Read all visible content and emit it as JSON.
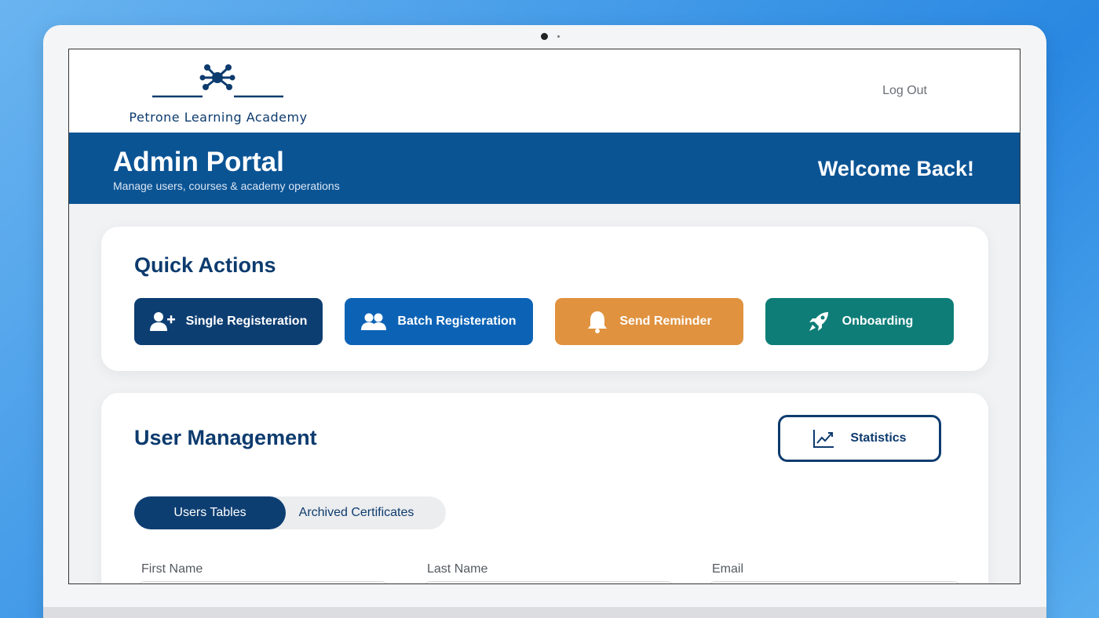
{
  "brand": {
    "name": "Petrone Learning Academy",
    "primary_color": "#0d3b6e",
    "accent_blue": "#0b5494"
  },
  "header": {
    "logout_label": "Log Out"
  },
  "hero": {
    "title": "Admin Portal",
    "subtitle": "Manage users, courses & academy operations",
    "welcome": "Welcome Back!"
  },
  "quick_actions": {
    "title": "Quick Actions",
    "buttons": [
      {
        "label": "Single Registeration",
        "icon": "add-user-icon",
        "color": "#0d3e72"
      },
      {
        "label": "Batch Registeration",
        "icon": "users-icon",
        "color": "#0c63b6"
      },
      {
        "label": "Send Reminder",
        "icon": "bell-icon",
        "color": "#e0923f"
      },
      {
        "label": "Onboarding",
        "icon": "rocket-icon",
        "color": "#0e7d78"
      }
    ]
  },
  "user_management": {
    "title": "User Management",
    "statistics_label": "Statistics",
    "statistics_icon": "chart-trend-icon",
    "tabs": [
      {
        "label": "Users Tables",
        "active": true
      },
      {
        "label": "Archived Certificates",
        "active": false
      }
    ],
    "fields": [
      {
        "label": "First Name"
      },
      {
        "label": "Last Name"
      },
      {
        "label": "Email"
      }
    ]
  }
}
